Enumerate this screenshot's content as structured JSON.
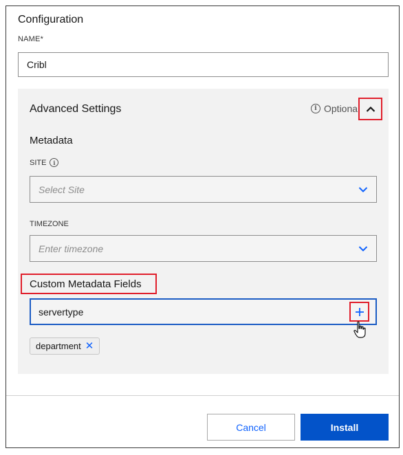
{
  "config": {
    "title": "Configuration",
    "name_label": "NAME*",
    "name_value": "Cribl"
  },
  "advanced": {
    "title": "Advanced Settings",
    "optional_label": "Optiona",
    "collapse_icon": "chevron-up-icon",
    "metadata_title": "Metadata",
    "site": {
      "label": "SITE",
      "placeholder": "Select Site"
    },
    "timezone": {
      "label": "TIMEZONE",
      "placeholder": "Enter timezone"
    },
    "custom_fields": {
      "title": "Custom Metadata Fields",
      "input_value": "servertype",
      "add_icon": "plus-icon",
      "tags": [
        "department"
      ]
    }
  },
  "footer": {
    "cancel_label": "Cancel",
    "install_label": "Install"
  },
  "colors": {
    "accent": "#0f62fe",
    "primary_button": "#0353c9",
    "highlight_box": "#e01e2b",
    "panel_bg": "#f2f2f2"
  }
}
